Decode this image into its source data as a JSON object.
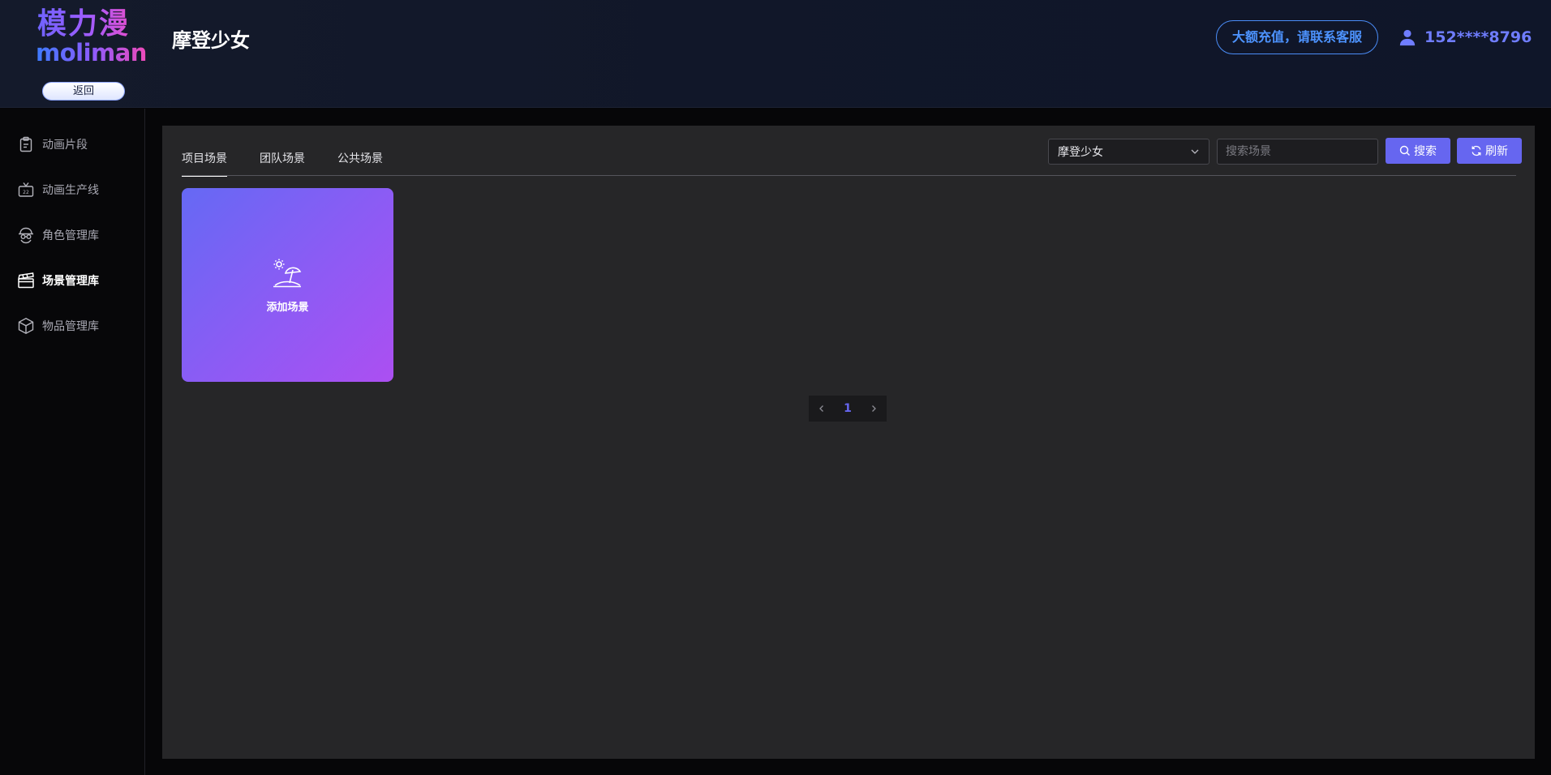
{
  "header": {
    "logo_cn": "模力漫",
    "logo_en": "moliman",
    "back_label": "返回",
    "project_title": "摩登少女",
    "recharge_label": "大额充值，请联系客服",
    "user_phone": "152****8796"
  },
  "sidebar": {
    "items": [
      {
        "label": "动画片段",
        "icon": "clipboard-icon",
        "active": false
      },
      {
        "label": "动画生产线",
        "icon": "tv-icon",
        "active": false
      },
      {
        "label": "角色管理库",
        "icon": "character-icon",
        "active": false
      },
      {
        "label": "场景管理库",
        "icon": "clapperboard-icon",
        "active": true
      },
      {
        "label": "物品管理库",
        "icon": "box-icon",
        "active": false
      }
    ]
  },
  "main": {
    "tabs": [
      {
        "label": "项目场景",
        "active": true
      },
      {
        "label": "团队场景",
        "active": false
      },
      {
        "label": "公共场景",
        "active": false
      }
    ],
    "project_select": {
      "value": "摩登少女"
    },
    "search": {
      "placeholder": "搜索场景",
      "value": ""
    },
    "search_button": "搜索",
    "refresh_button": "刷新",
    "add_card_label": "添加场景",
    "pagination": {
      "current": "1"
    }
  },
  "colors": {
    "accent": "#6666f0",
    "recharge": "#4d93ff",
    "card_gradient_start": "#6569f4",
    "card_gradient_end": "#ac4ff2"
  }
}
